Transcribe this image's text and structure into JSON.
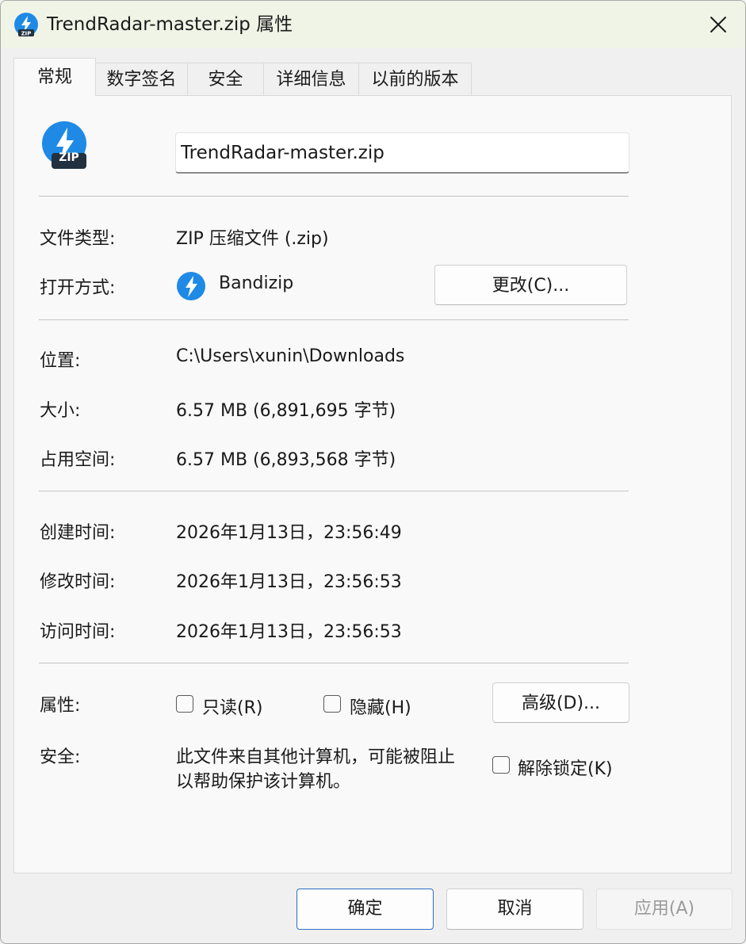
{
  "window": {
    "title": "TrendRadar-master.zip 属性"
  },
  "tabs": [
    {
      "label": "常规",
      "active": true
    },
    {
      "label": "数字签名"
    },
    {
      "label": "安全"
    },
    {
      "label": "详细信息"
    },
    {
      "label": "以前的版本"
    }
  ],
  "file": {
    "icon": "zip-file-icon",
    "icon_text": "ZIP",
    "name": "TrendRadar-master.zip"
  },
  "props": {
    "type_label": "文件类型:",
    "type_value": "ZIP 压缩文件 (.zip)",
    "opens_label": "打开方式:",
    "opens_value": "Bandizip",
    "change_button": "更改(C)...",
    "location_label": "位置:",
    "location_value": "C:\\Users\\xunin\\Downloads",
    "size_label": "大小:",
    "size_value": "6.57 MB (6,891,695 字节)",
    "disk_label": "占用空间:",
    "disk_value": "6.57 MB (6,893,568 字节)",
    "created_label": "创建时间:",
    "created_value": "2026年1月13日，23:56:49",
    "modified_label": "修改时间:",
    "modified_value": "2026年1月13日，23:56:53",
    "accessed_label": "访问时间:",
    "accessed_value": "2026年1月13日，23:56:53",
    "attributes_label": "属性:",
    "readonly_label": "只读(R)",
    "readonly_checked": false,
    "hidden_label": "隐藏(H)",
    "hidden_checked": false,
    "advanced_button": "高级(D)...",
    "security_label": "安全:",
    "security_text_line1": "此文件来自其他计算机，可能被阻止",
    "security_text_line2": "以帮助保护该计算机。",
    "unblock_label": "解除锁定(K)",
    "unblock_checked": false
  },
  "buttons": {
    "ok": "确定",
    "cancel": "取消",
    "apply": "应用(A)"
  },
  "colors": {
    "titlebar": "#f0f4e6",
    "accent": "#2b6ec7",
    "bandizip_blue": "#1e8ae6"
  }
}
